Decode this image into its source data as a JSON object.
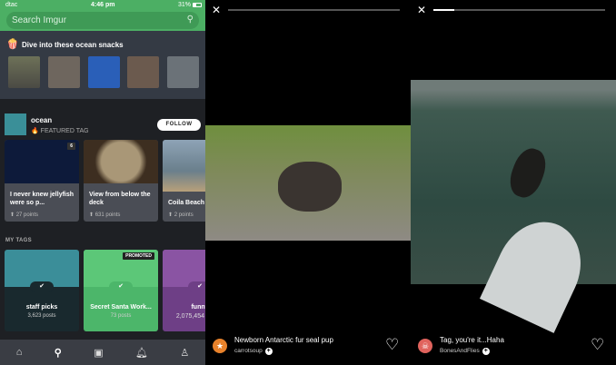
{
  "status": {
    "carrier": "dtac",
    "time": "4:46 pm",
    "battery": "31%"
  },
  "search": {
    "placeholder": "Search Imgur"
  },
  "snacks": {
    "title": "Dive into these ocean snacks"
  },
  "featured": {
    "name": "ocean",
    "sub": "FEATURED TAG",
    "follow": "FOLLOW"
  },
  "posts": [
    {
      "title": "I never knew jellyfish were so p...",
      "points": "27 points",
      "badge": "6"
    },
    {
      "title": "View from below the deck",
      "points": "631 points"
    },
    {
      "title": "Coila Beach",
      "points": "2 points"
    }
  ],
  "my_tags": {
    "label": "MY TAGS",
    "items": [
      {
        "name": "staff picks",
        "count": "3,623 posts"
      },
      {
        "name": "Secret Santa Work...",
        "count": "73 posts",
        "badge": "PROMOTED"
      },
      {
        "name": "funny",
        "count": "2,075,454"
      }
    ]
  },
  "viewers": [
    {
      "title": "Newborn Antarctic fur seal pup",
      "user": "carrotsoup",
      "progress": 0
    },
    {
      "title": "Tag, you're it...Haha",
      "user": "BonesAndFlies",
      "progress": 0.12
    }
  ]
}
